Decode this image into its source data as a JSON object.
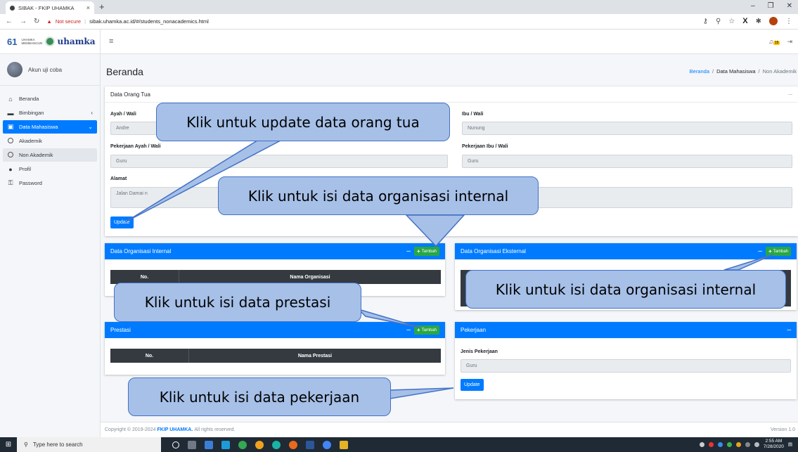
{
  "browser": {
    "tab_title": "SIBAK - FKIP UHAMKA",
    "security": "Not secure",
    "url": "sibak.uhamka.ac.id/#/students_nonacademics.html"
  },
  "brand": {
    "tagline": "UHAMKA MEMBANGUN",
    "name": "uhamka"
  },
  "user": {
    "name": "Akun uji coba"
  },
  "sidebar": {
    "items": [
      {
        "label": "Beranda",
        "icon": "home-icon"
      },
      {
        "label": "Bimbingan",
        "icon": "book-icon"
      },
      {
        "label": "Data Mahasiswa",
        "icon": "id-card-icon"
      },
      {
        "label": "Akademik",
        "icon": "circle-icon"
      },
      {
        "label": "Non Akademik",
        "icon": "circle-icon"
      },
      {
        "label": "Profil",
        "icon": "user-icon"
      },
      {
        "label": "Password",
        "icon": "key-icon"
      }
    ]
  },
  "header": {
    "notif_count": "15"
  },
  "page": {
    "title": "Beranda",
    "breadcrumb": [
      "Beranda",
      "Data Mahasiswa",
      "Non Akademik"
    ]
  },
  "orangtua": {
    "title": "Data Orang Tua",
    "ayah_label": "Ayah / Wali",
    "ayah_value": "Andre",
    "ibu_label": "Ibu / Wali",
    "ibu_value": "Nunung",
    "pek_ayah_label": "Pekerjaan Ayah / Wali",
    "pek_ayah_value": "Guru",
    "pek_ibu_label": "Pekerjaan Ibu / Wali",
    "pek_ibu_value": "Guru",
    "alamat_label": "Alamat",
    "alamat_value": "Jalan Damai n",
    "update": "Update"
  },
  "org_internal": {
    "title": "Data Organisasi Internal",
    "add": "Tambah",
    "col_no": "No.",
    "col_name": "Nama Organisasi"
  },
  "org_eksternal": {
    "title": "Data Organisasi Eksternal",
    "add": "Tambah"
  },
  "prestasi": {
    "title": "Prestasi",
    "add": "Tambah",
    "col_no": "No.",
    "col_name": "Nama Prestasi"
  },
  "pekerjaan": {
    "title": "Pekerjaan",
    "label": "Jenis Pekerjaan",
    "value": "Guru",
    "update": "Update"
  },
  "footer": {
    "prefix": "Copyright © 2019-2024",
    "org": "FKIP UHAMKA.",
    "suffix": "All rights reserved.",
    "version": "Version 1.0"
  },
  "callouts": {
    "orangtua": "Klik untuk update data orang tua",
    "org_internal": "Klik untuk isi data organisasi internal",
    "org_eksternal": "Klik untuk isi data organisasi internal",
    "prestasi": "Klik untuk isi data prestasi",
    "pekerjaan": "Klik untuk isi data pekerjaan"
  },
  "taskbar": {
    "search": "Type here to search",
    "time": "2:55 AM",
    "date": "7/28/2020"
  },
  "colors": {
    "primary": "#007bff",
    "success": "#28a745",
    "dark": "#343a40",
    "callout": "#a6c0e8"
  }
}
